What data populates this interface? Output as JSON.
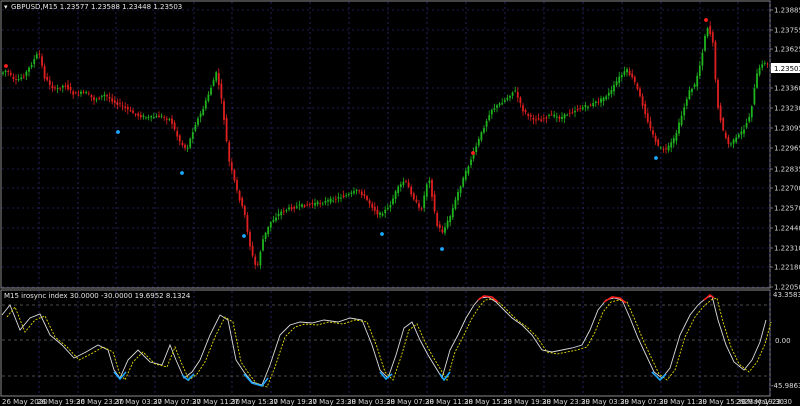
{
  "main_chart": {
    "header": "GBPUSD,M15  1.23577 1.23588 1.23448 1.23503",
    "current_price": "1.23503",
    "price_levels": [
      "1.23885",
      "1.23755",
      "1.23625",
      "1.23503",
      "1.23360",
      "1.23230",
      "1.23095",
      "1.22965",
      "1.22835",
      "1.22700",
      "1.22570",
      "1.22440",
      "1.22310",
      "1.22180",
      "1.22050"
    ]
  },
  "indicator": {
    "header": "M15 irosync index 30.0000 -30.0000 19.6952 8.1324",
    "levels": [
      "43.3583",
      "0.00",
      "-45.9863"
    ]
  },
  "time_axis": [
    "26 May 2020",
    "26 May 19:30",
    "26 May 23:30",
    "27 May 03:30",
    "27 May 07:30",
    "27 May 11:30",
    "27 May 15:30",
    "27 May 19:30",
    "27 May 23:30",
    "28 May 03:30",
    "28 May 07:30",
    "28 May 11:30",
    "28 May 15:30",
    "28 May 19:30",
    "28 May 23:30",
    "29 May 03:30",
    "29 May 07:30",
    "29 May 11:30",
    "29 May 15:30",
    "29 May 19:30",
    "29 May 23:30"
  ],
  "colors": {
    "bull": "#1fb51f",
    "bear": "#e02020",
    "grid": "#3a3a9a",
    "dot_red": "#ff2020",
    "dot_blue": "#1ca8ff"
  }
}
